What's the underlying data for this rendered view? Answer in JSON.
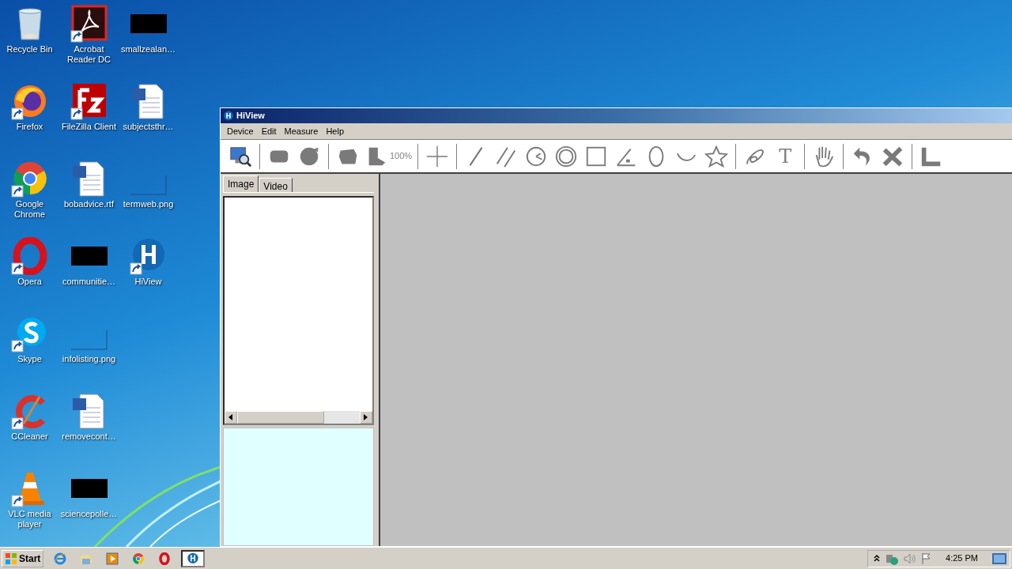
{
  "desktop": {
    "icons": [
      {
        "label": "Recycle Bin",
        "kind": "recycle-bin",
        "shortcut": false
      },
      {
        "label": "Firefox",
        "kind": "firefox",
        "shortcut": true
      },
      {
        "label": "Google Chrome",
        "kind": "chrome",
        "shortcut": true
      },
      {
        "label": "Opera",
        "kind": "opera",
        "shortcut": true
      },
      {
        "label": "Skype",
        "kind": "skype",
        "shortcut": true
      },
      {
        "label": "CCleaner",
        "kind": "ccleaner",
        "shortcut": true
      },
      {
        "label": "VLC media player",
        "kind": "vlc",
        "shortcut": true
      },
      {
        "label": "Acrobat Reader DC",
        "kind": "acrobat",
        "shortcut": true
      },
      {
        "label": "FileZilla Client",
        "kind": "filezilla",
        "shortcut": true
      },
      {
        "label": "bobadvice.rtf",
        "kind": "document",
        "shortcut": false
      },
      {
        "label": "communitie…",
        "kind": "dark-thumbnail",
        "shortcut": false
      },
      {
        "label": "infolisting.png",
        "kind": "blank-thumbnail",
        "shortcut": false
      },
      {
        "label": "removecont…",
        "kind": "document",
        "shortcut": false
      },
      {
        "label": "sciencepolle…",
        "kind": "dark-thumbnail",
        "shortcut": false
      },
      {
        "label": "smallzealan…",
        "kind": "dark-thumbnail",
        "shortcut": false
      },
      {
        "label": "subjectsthr…",
        "kind": "document",
        "shortcut": false
      },
      {
        "label": "termweb.png",
        "kind": "blank-thumbnail",
        "shortcut": false
      },
      {
        "label": "HiView",
        "kind": "hiview",
        "shortcut": true
      }
    ]
  },
  "window": {
    "title": "HiView",
    "menu": [
      "Device",
      "Edit",
      "Measure",
      "Help"
    ],
    "toolbar": [
      {
        "kind": "monitor"
      },
      {
        "kind": "separator"
      },
      {
        "kind": "camera"
      },
      {
        "kind": "reel"
      },
      {
        "kind": "separator"
      },
      {
        "kind": "blob"
      },
      {
        "kind": "zoom",
        "label": "100%"
      },
      {
        "kind": "separator"
      },
      {
        "kind": "crosshair"
      },
      {
        "kind": "separator"
      },
      {
        "kind": "line"
      },
      {
        "kind": "parallel"
      },
      {
        "kind": "clock"
      },
      {
        "kind": "rings"
      },
      {
        "kind": "square"
      },
      {
        "kind": "angle"
      },
      {
        "kind": "ellipse"
      },
      {
        "kind": "arc"
      },
      {
        "kind": "star"
      },
      {
        "kind": "separator"
      },
      {
        "kind": "freehand"
      },
      {
        "kind": "text",
        "label": "T"
      },
      {
        "kind": "separator"
      },
      {
        "kind": "hand"
      },
      {
        "kind": "separator"
      },
      {
        "kind": "undo"
      },
      {
        "kind": "cross"
      },
      {
        "kind": "separator"
      },
      {
        "kind": "corner"
      }
    ],
    "tabs": [
      {
        "label": "Image",
        "selected": true
      },
      {
        "label": "Video",
        "selected": false
      }
    ]
  },
  "taskbar": {
    "start": "Start",
    "apps": [
      {
        "kind": "ie",
        "selected": false
      },
      {
        "kind": "folder",
        "selected": false
      },
      {
        "kind": "media",
        "selected": false
      },
      {
        "kind": "chrome",
        "selected": false
      },
      {
        "kind": "opera",
        "selected": false
      },
      {
        "kind": "hiview",
        "selected": true
      }
    ],
    "tray": [
      {
        "kind": "chevron"
      },
      {
        "kind": "network"
      },
      {
        "kind": "volume"
      },
      {
        "kind": "flag"
      }
    ],
    "clock": "4:25 PM"
  }
}
